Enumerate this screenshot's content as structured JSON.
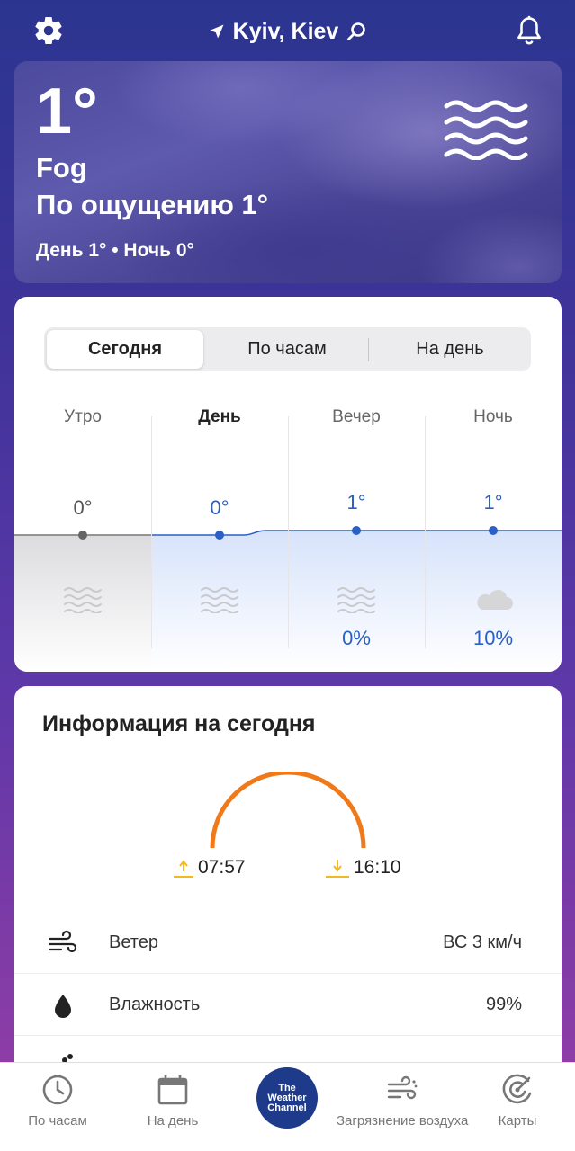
{
  "header": {
    "location": "Kyiv, Kiev"
  },
  "current": {
    "temperature": "1°",
    "condition": "Fog",
    "feels_like": "По ощущению 1°",
    "day_night": "День 1° • Ночь 0°"
  },
  "forecast": {
    "tabs": [
      "Сегодня",
      "По часам",
      "На день"
    ],
    "periods": [
      {
        "label": "Утро",
        "temp": "0°",
        "precip": ""
      },
      {
        "label": "День",
        "temp": "0°",
        "precip": ""
      },
      {
        "label": "Вечер",
        "temp": "1°",
        "precip": "0%"
      },
      {
        "label": "Ночь",
        "temp": "1°",
        "precip": "10%"
      }
    ]
  },
  "info": {
    "title": "Информация на сегодня",
    "sunrise": "07:57",
    "sunset": "16:10",
    "rows": [
      {
        "label": "Ветер",
        "value": "ВС 3 км/ч",
        "icon": "wind-icon"
      },
      {
        "label": "Влажность",
        "value": "99%",
        "icon": "humidity-drop-icon"
      }
    ]
  },
  "tabbar": {
    "items": [
      {
        "label": "По часам",
        "icon": "clock-icon"
      },
      {
        "label": "На день",
        "icon": "calendar-icon"
      },
      {
        "label": "The Weather Channel",
        "icon": "twc-logo"
      },
      {
        "label": "Загрязнение воздуха",
        "icon": "air-quality-icon"
      },
      {
        "label": "Карты",
        "icon": "radar-icon"
      }
    ]
  },
  "colors": {
    "accent_blue": "#2a5fc5",
    "sun_arc": "#f07a1a",
    "sun_marker": "#f2b820"
  }
}
